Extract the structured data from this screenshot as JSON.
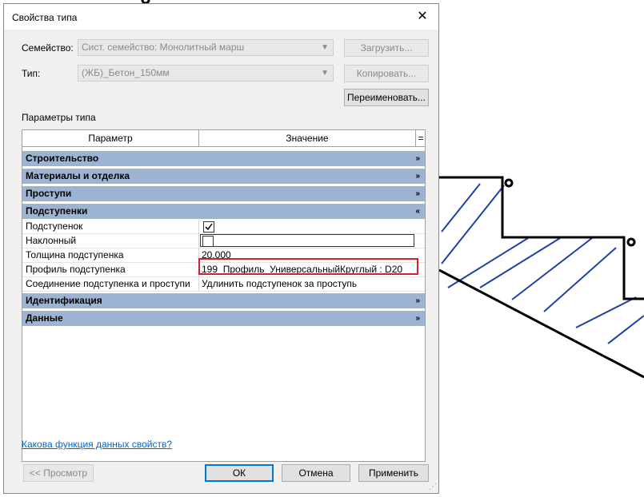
{
  "window": {
    "title": "Свойства типа"
  },
  "family": {
    "label": "Семейство:",
    "value": "Сист. семейство: Монолитный марш",
    "load_button": "Загрузить..."
  },
  "type": {
    "label": "Тип:",
    "value": "(ЖБ)_Бетон_150мм",
    "copy_button": "Копировать...",
    "rename_button": "Переименовать..."
  },
  "params_title": "Параметры типа",
  "grid": {
    "col_param": "Параметр",
    "col_value": "Значение",
    "col_btn": "=",
    "groups": [
      {
        "label": "Строительство",
        "chev": "»"
      },
      {
        "label": "Материалы и отделка",
        "chev": "»"
      },
      {
        "label": "Проступи",
        "chev": "»"
      },
      {
        "label": "Подступенки",
        "chev": "«"
      },
      {
        "label": "Идентификация",
        "chev": "»"
      },
      {
        "label": "Данные",
        "chev": "»"
      }
    ],
    "rows": [
      {
        "name": "Подступенок",
        "value": "",
        "checked": true
      },
      {
        "name": "Наклонный",
        "value": "",
        "checked": false
      },
      {
        "name": "Толщина подступенка",
        "value": "20.000"
      },
      {
        "name": "Профиль подступенка",
        "value": "199_Профиль_УниверсальныйКруглый : D20"
      },
      {
        "name": "Соединение подступенка и проступи",
        "value": "Удлинить подступенок за проступь"
      }
    ]
  },
  "help_link": "Какова функция данных свойств?",
  "buttons": {
    "preview": "<< Просмотр",
    "ok": "ОК",
    "cancel": "Отмена",
    "apply": "Применить"
  },
  "colors": {
    "group_header": "#9cb4d2",
    "highlight": "#d2232a",
    "hatch": "#1f3fa8",
    "link": "#0066cc"
  }
}
